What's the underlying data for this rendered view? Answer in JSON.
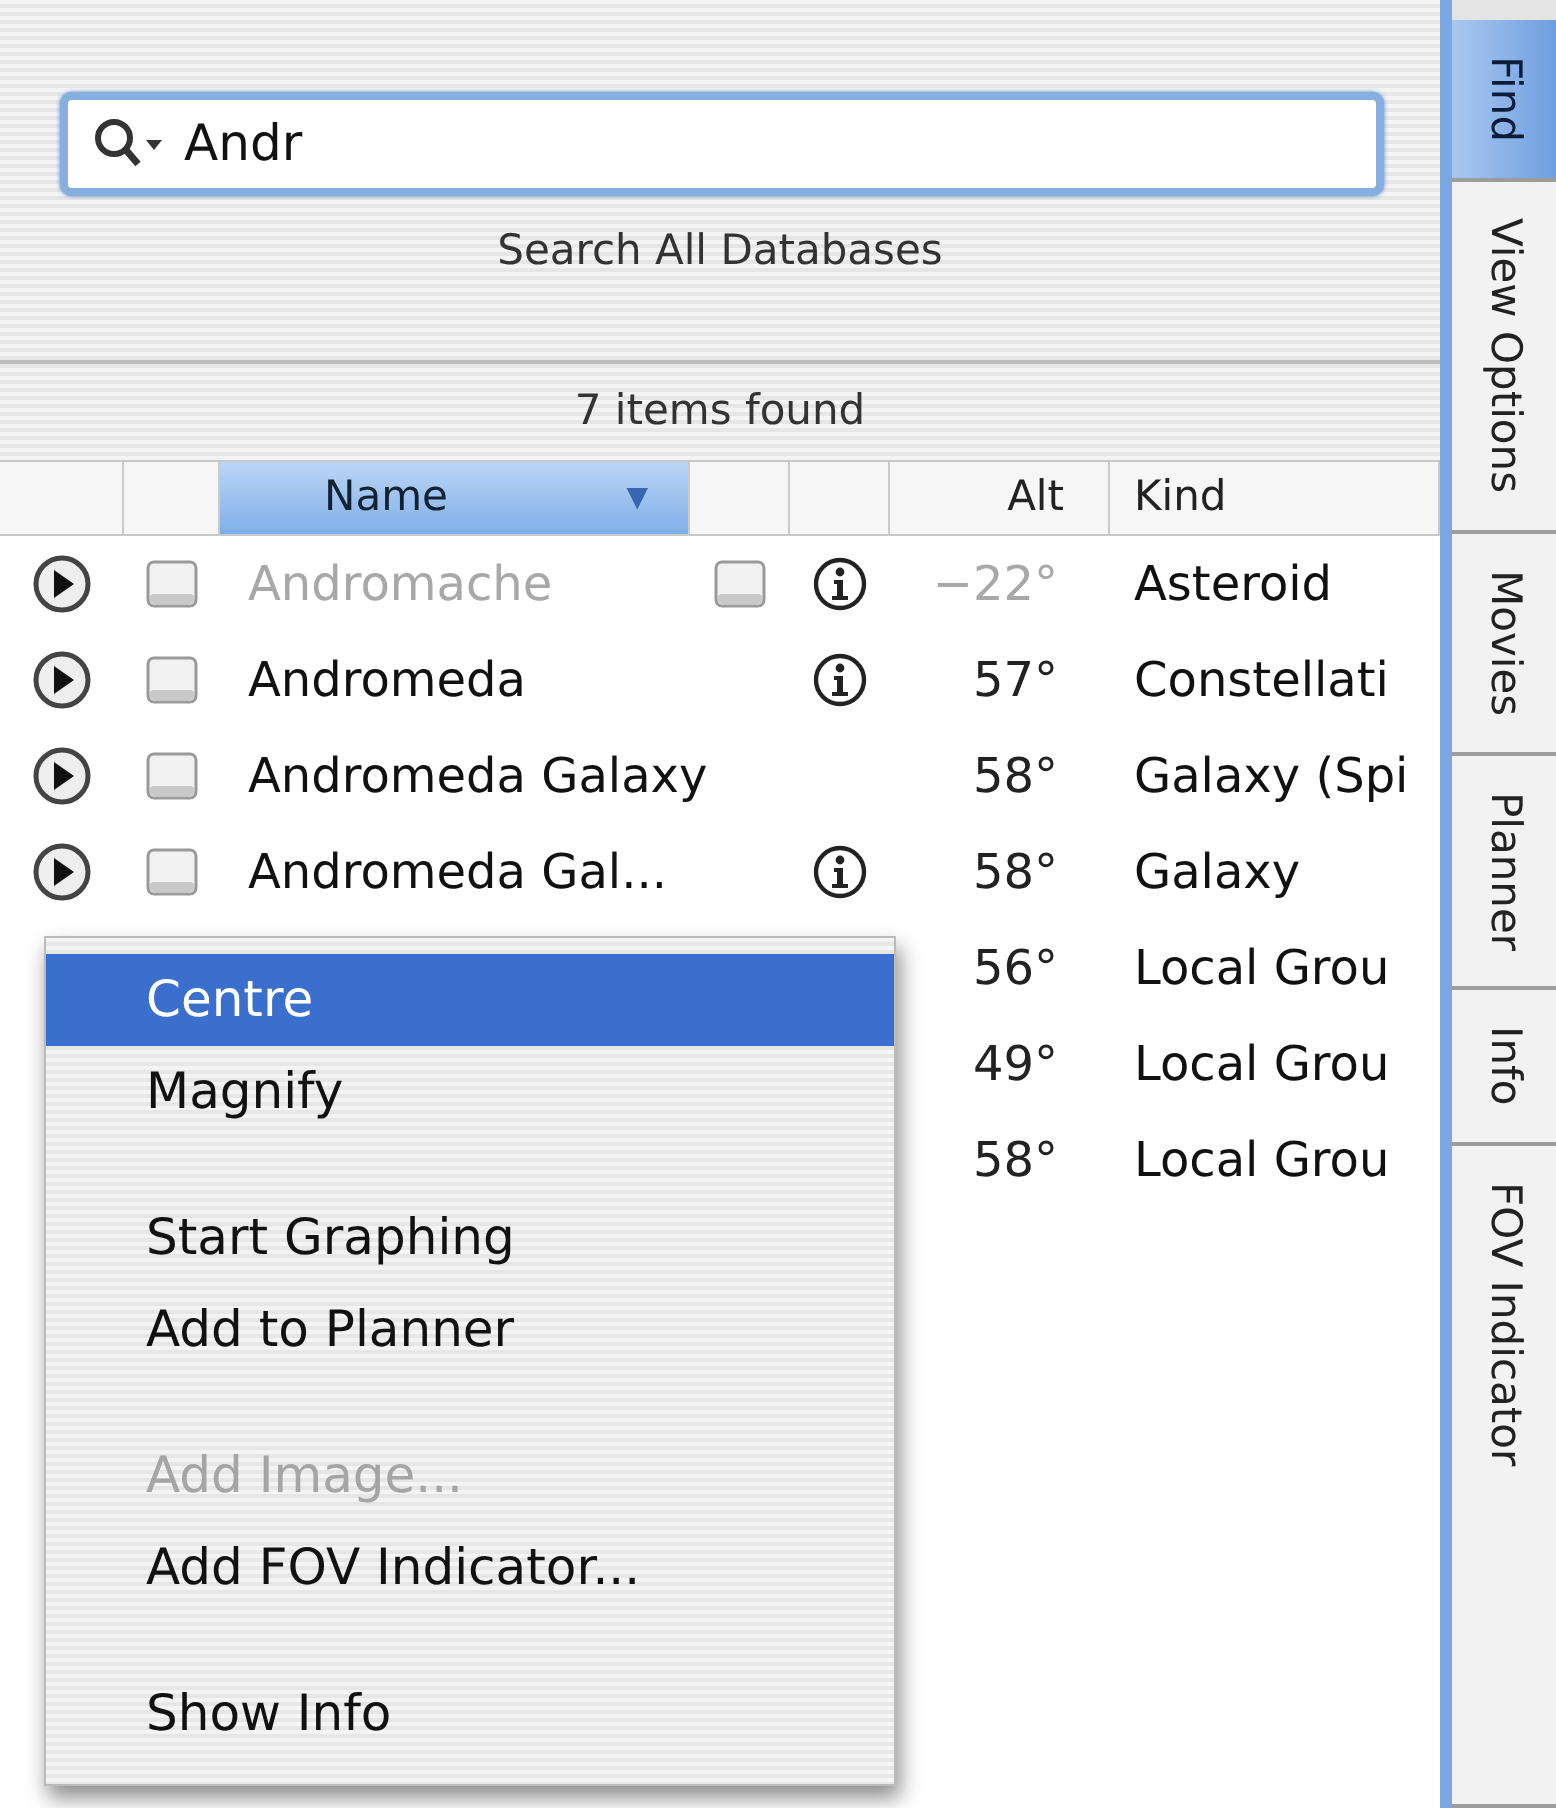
{
  "search": {
    "value": "Andr",
    "scope": "Search All Databases"
  },
  "status": "7 items found",
  "columns": [
    {
      "label": "Name",
      "selected": true,
      "sort": "▼"
    },
    {
      "label": "Alt",
      "selected": false
    },
    {
      "label": "Kind",
      "selected": false
    }
  ],
  "rows": [
    {
      "name": "Andromache",
      "checked": false,
      "dimmed": true,
      "option": {
        "checked": false
      },
      "info": true,
      "alt": "−22°",
      "kind": "Asteroid"
    },
    {
      "name": "Andromeda",
      "checked": false,
      "dimmed": false,
      "info": true,
      "alt": "57°",
      "kind": "Constellati"
    },
    {
      "name": "Andromeda Galaxy",
      "checked": false,
      "dimmed": false,
      "info": false,
      "alt": "58°",
      "kind": "Galaxy (Spi"
    },
    {
      "name": "Andromeda Gal...",
      "checked": false,
      "dimmed": false,
      "info": true,
      "alt": "58°",
      "kind": "Galaxy"
    },
    {
      "alt": "56°",
      "kind": "Local Grou"
    },
    {
      "alt": "49°",
      "kind": "Local Grou"
    },
    {
      "alt": "58°",
      "kind": "Local Grou"
    }
  ],
  "context_menu": [
    {
      "kind": "item",
      "label": "Centre",
      "selected": true,
      "disabled": false
    },
    {
      "kind": "item",
      "label": "Magnify",
      "selected": false,
      "disabled": false
    },
    {
      "kind": "separator"
    },
    {
      "kind": "item",
      "label": "Start Graphing",
      "selected": false,
      "disabled": false
    },
    {
      "kind": "item",
      "label": "Add to Planner",
      "selected": false,
      "disabled": false
    },
    {
      "kind": "separator"
    },
    {
      "kind": "item",
      "label": "Add Image...",
      "selected": false,
      "disabled": true
    },
    {
      "kind": "item",
      "label": "Add FOV Indicator...",
      "selected": false,
      "disabled": false
    },
    {
      "kind": "separator"
    },
    {
      "kind": "item",
      "label": "Show Info",
      "selected": false,
      "disabled": false
    }
  ],
  "side_tabs": [
    {
      "label": "Find",
      "selected": true
    },
    {
      "label": "View Options",
      "selected": false
    },
    {
      "label": "Movies",
      "selected": false
    },
    {
      "label": "Planner",
      "selected": false
    },
    {
      "label": "Info",
      "selected": false
    },
    {
      "label": "FOV Indicator",
      "selected": false
    }
  ]
}
